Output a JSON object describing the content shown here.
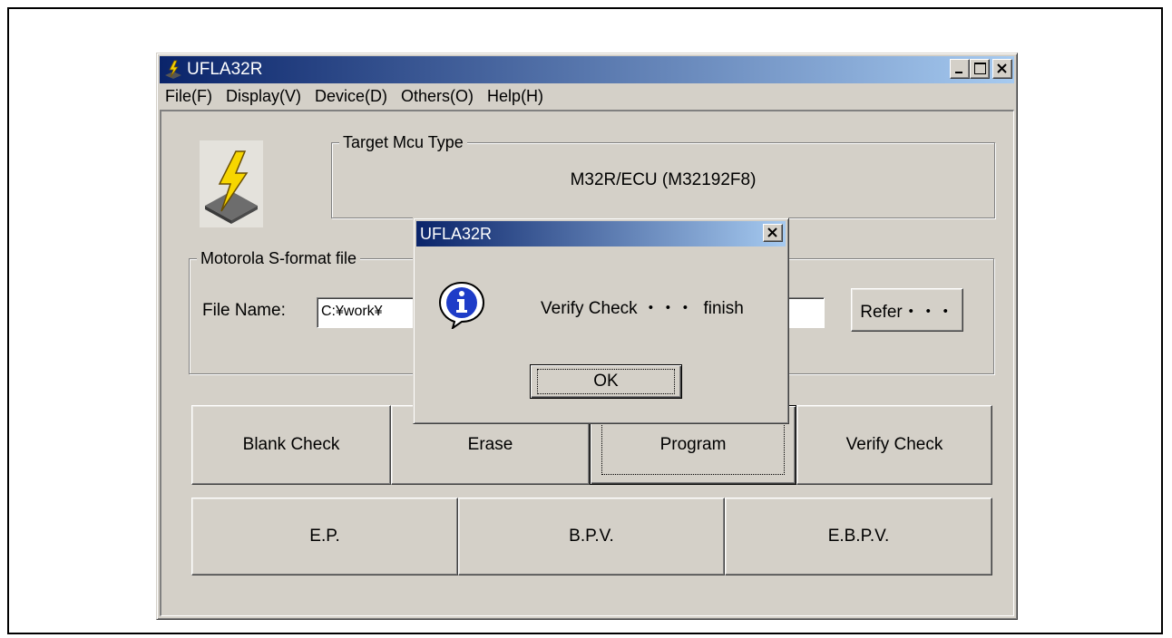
{
  "window": {
    "title": "UFLA32R"
  },
  "menu": [
    "File(F)",
    "Display(V)",
    "Device(D)",
    "Others(O)",
    "Help(H)"
  ],
  "target": {
    "legend": "Target Mcu Type",
    "value": "M32R/ECU (M32192F8)"
  },
  "file_group": {
    "legend": "Motorola S-format file",
    "label": "File Name:",
    "value": "C:¥work¥",
    "refer_label": "Refer・・・"
  },
  "buttons_row1": [
    "Blank Check",
    "Erase",
    "Program",
    "Verify Check"
  ],
  "buttons_row2": [
    "E.P.",
    "B.P.V.",
    "E.B.P.V."
  ],
  "dialog": {
    "title": "UFLA32R",
    "message": "Verify Check ・・・  finish",
    "ok_label": "OK",
    "icon": "info-icon"
  },
  "colors": {
    "titlebar_start": "#0a246a",
    "titlebar_end": "#a6caf0",
    "face": "#d4d0c8"
  }
}
